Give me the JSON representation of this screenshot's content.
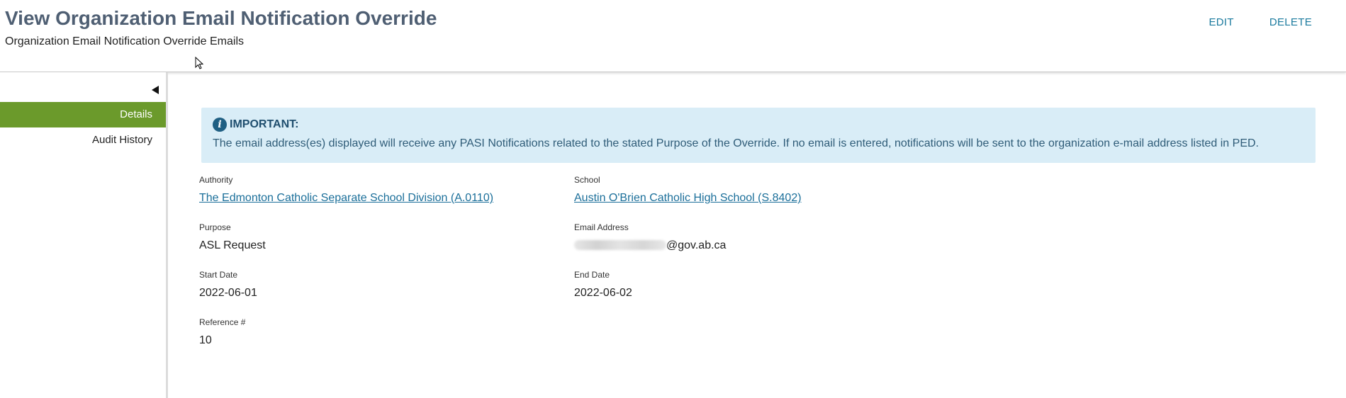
{
  "header": {
    "title": "View Organization Email Notification Override",
    "subtitle": "Organization Email Notification Override Emails",
    "actions": {
      "edit": "EDIT",
      "delete": "DELETE"
    }
  },
  "sidebar": {
    "items": [
      {
        "label": "Details",
        "active": true
      },
      {
        "label": "Audit History",
        "active": false
      }
    ]
  },
  "notice": {
    "title": "IMPORTANT:",
    "text": "The email address(es) displayed will receive any PASI Notifications related to the stated Purpose of the Override. If no email is entered, notifications will be sent to the organization e-mail address listed in PED."
  },
  "fields": {
    "authority": {
      "label": "Authority",
      "value": "The Edmonton Catholic Separate School Division (A.0110)"
    },
    "school": {
      "label": "School",
      "value": "Austin O'Brien Catholic High School (S.8402)"
    },
    "purpose": {
      "label": "Purpose",
      "value": "ASL Request"
    },
    "email": {
      "label": "Email Address",
      "value": "@gov.ab.ca"
    },
    "start_date": {
      "label": "Start Date",
      "value": "2022-06-01"
    },
    "end_date": {
      "label": "End Date",
      "value": "2022-06-02"
    },
    "reference": {
      "label": "Reference #",
      "value": "10"
    }
  },
  "colors": {
    "accent_green": "#6b9a2b",
    "link_blue": "#1b6f9a",
    "notice_bg": "#d9edf7",
    "title_slate": "#4f5f73"
  }
}
